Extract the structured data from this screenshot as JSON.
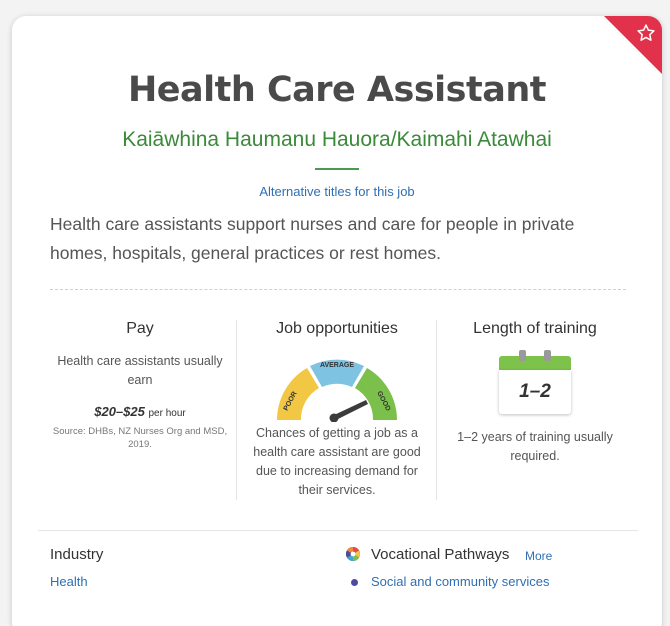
{
  "job": {
    "title": "Health Care Assistant",
    "maori_title": "Kaiāwhina Haumanu Hauora/Kaimahi Atawhai",
    "alt_titles_link": "Alternative titles for this job",
    "description": "Health care assistants support nurses and care for people in private homes, hospitals, general practices or rest homes."
  },
  "pay": {
    "heading": "Pay",
    "text": "Health care assistants usually earn",
    "amount": "$20–$25",
    "per": "per hour",
    "source": "Source: DHBs, NZ Nurses Org and MSD, 2019."
  },
  "opportunities": {
    "heading": "Job opportunities",
    "gauge_labels": [
      "POOR",
      "AVERAGE",
      "GOOD"
    ],
    "gauge_colors": [
      "#f2c744",
      "#7fc3e3",
      "#7cc04c"
    ],
    "level": "good",
    "text": "Chances of getting a job as a health care assistant are good due to increasing demand for their services."
  },
  "training": {
    "heading": "Length of training",
    "calendar_value": "1–2",
    "text": "1–2 years of training usually required."
  },
  "industry": {
    "heading": "Industry",
    "link": "Health"
  },
  "vocational": {
    "heading": "Vocational Pathways",
    "more": "More",
    "link": "Social and community services",
    "dot_color": "#4f4aa0"
  },
  "accent_colors": {
    "corner": "#e2324b",
    "maori_title": "#3a8a3a",
    "link": "#2f6fb5"
  },
  "icons": [
    "star-icon",
    "gauge-icon",
    "calendar-icon",
    "vocational-pathways-icon"
  ]
}
